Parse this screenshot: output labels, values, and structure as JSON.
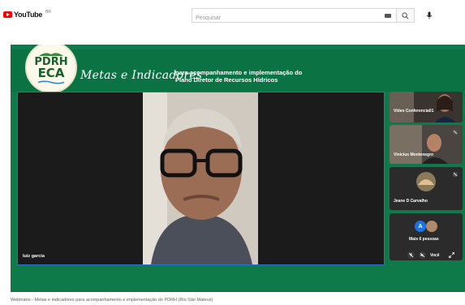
{
  "youtube": {
    "logo_text": "YouTube",
    "country_code": "BR",
    "search_placeholder": "Pesquisar",
    "icons": {
      "keyboard": "keyboard-icon",
      "search": "search-icon",
      "mic": "mic-icon"
    }
  },
  "banner": {
    "logo_line1": "PDRH",
    "logo_line2": "ECA",
    "script_title": "Metas e Indicadores",
    "subtitle_line1": "para acompanhamento e implementação do",
    "subtitle_line2": "Plano Diretor de Recursos Hídricos"
  },
  "meeting": {
    "speaker_name": "luiz garcia",
    "participants": [
      {
        "name": "Video Conferencia01"
      },
      {
        "name": "Vinicius Montenegro"
      },
      {
        "name": "Jeane D Carvalho"
      },
      {
        "name": "Mais 6 pessoas",
        "avatar_letter": "A"
      }
    ],
    "self_label": "Você"
  },
  "video_title": "Webinário - Metas e indicadores para acompanhamento e implementação do PDRH (Rio São Mateus)",
  "colors": {
    "brand_green": "#0a7243",
    "youtube_red": "#ff0000",
    "active_border": "#2d6be0"
  }
}
